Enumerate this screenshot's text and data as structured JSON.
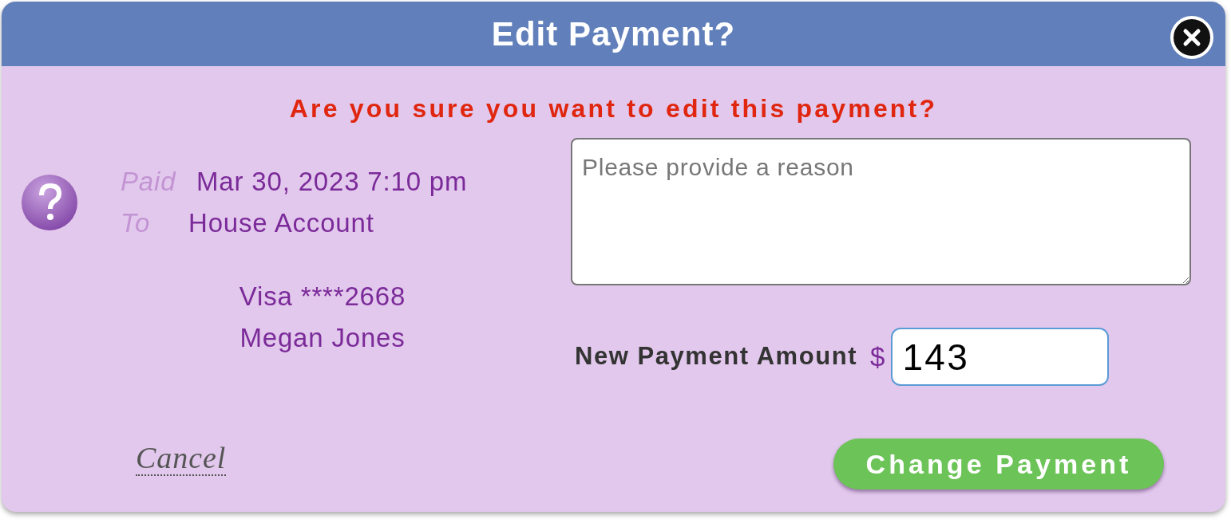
{
  "dialog": {
    "title": "Edit Payment?"
  },
  "warning": "Are you sure you want to edit this payment?",
  "details": {
    "paid_label": "Paid",
    "paid_value": "Mar 30, 2023 7:10 pm",
    "to_label": "To",
    "to_value": "House Account",
    "card": "Visa ****2668",
    "name": "Megan Jones"
  },
  "reason": {
    "placeholder": "Please provide a reason"
  },
  "amount": {
    "label": "New Payment Amount",
    "currency": "$",
    "value": "143"
  },
  "buttons": {
    "cancel": "Cancel",
    "submit": "Change Payment"
  }
}
